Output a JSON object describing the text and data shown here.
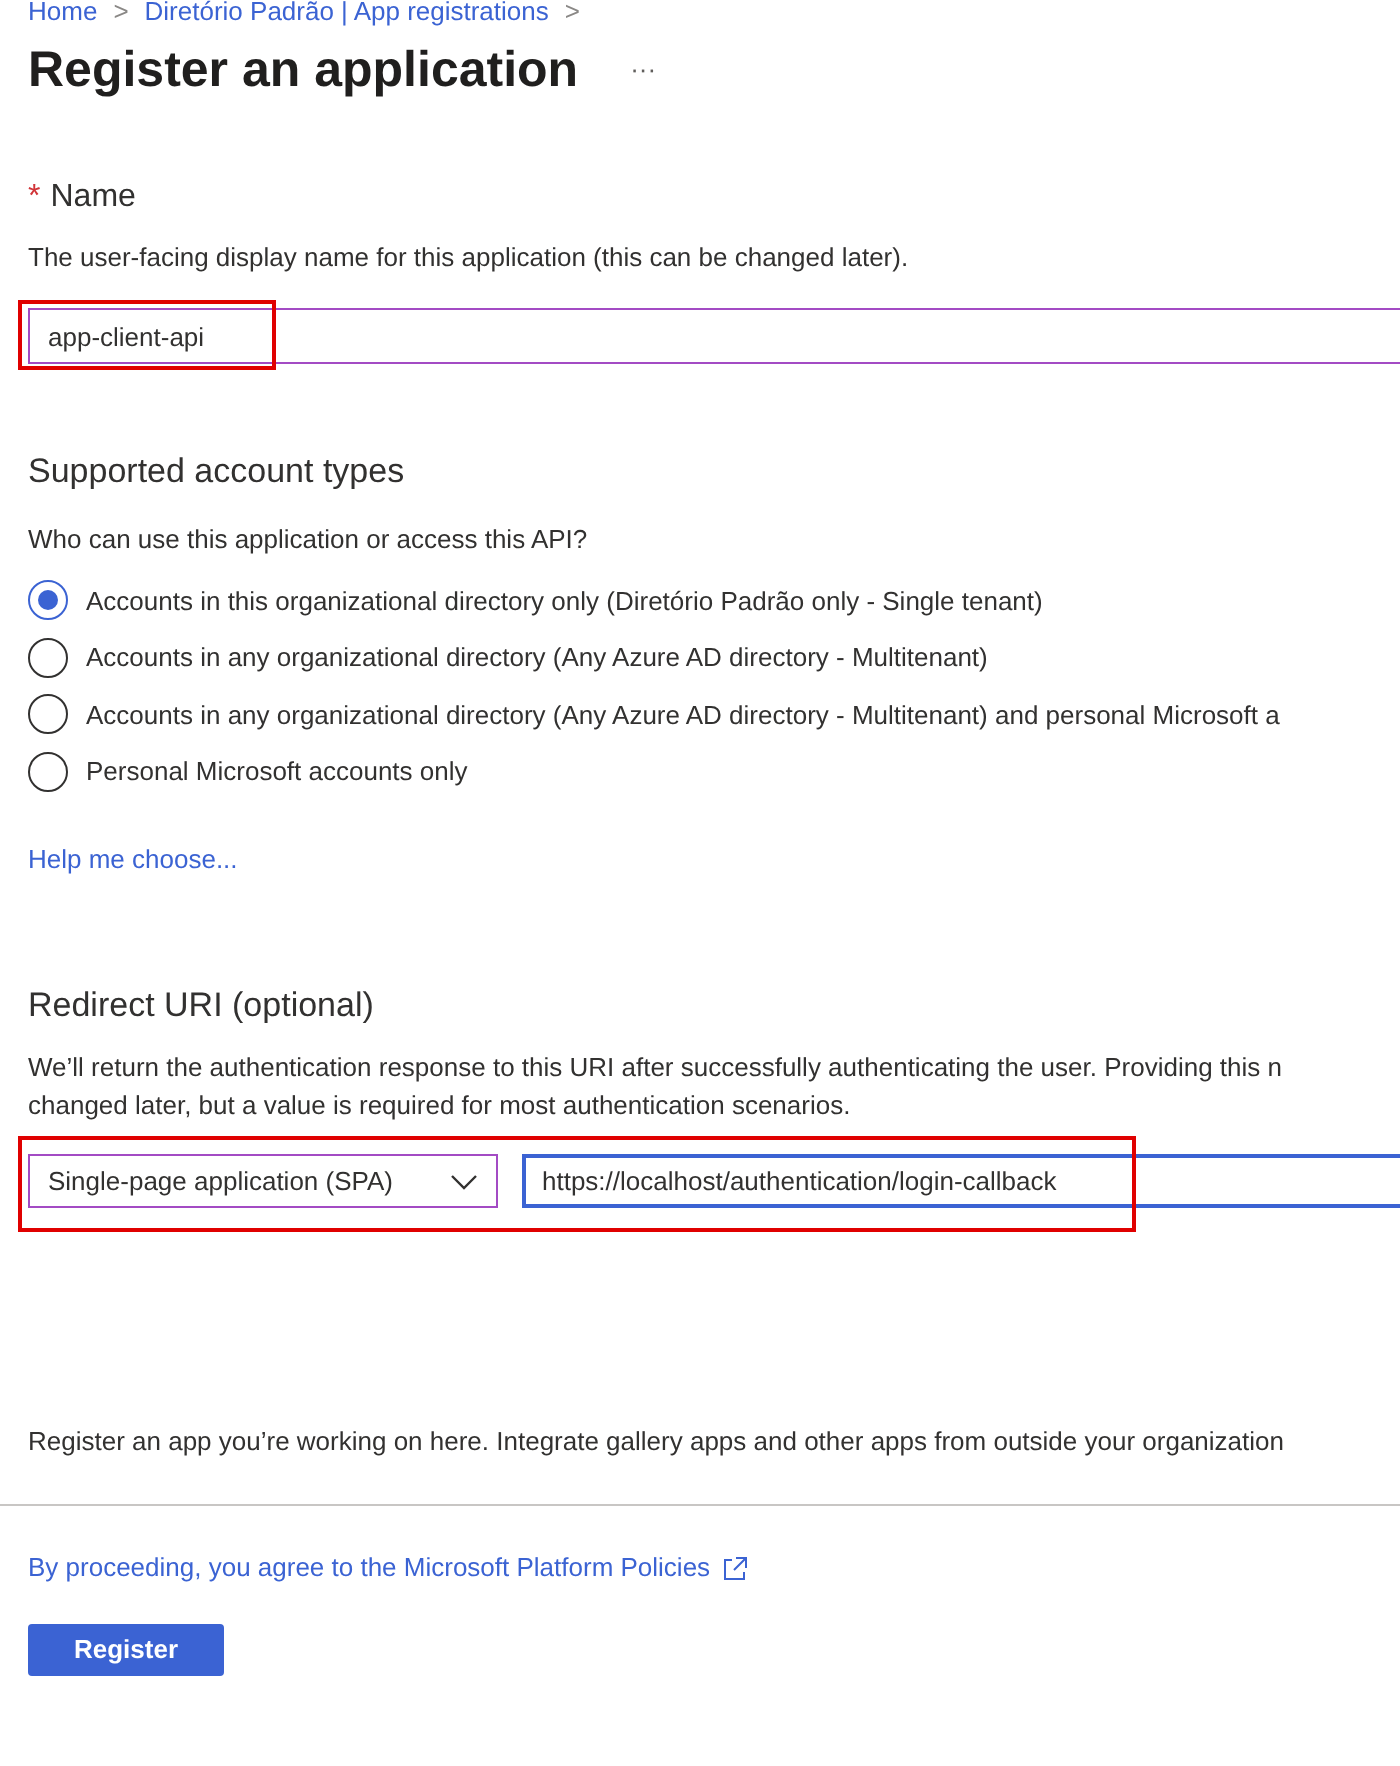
{
  "breadcrumb": [
    {
      "label": "Home"
    },
    {
      "label": "Diretório Padrão | App registrations"
    }
  ],
  "breadcrumb_separator": ">",
  "title": "Register an application",
  "more_menu": "···",
  "name_section": {
    "required_mark": "*",
    "label": "Name",
    "description": "The user-facing display name for this application (this can be changed later).",
    "value": "app-client-api"
  },
  "account_types": {
    "heading": "Supported account types",
    "question": "Who can use this application or access this API?",
    "options": [
      {
        "label": "Accounts in this organizational directory only (Diretório Padrão only - Single tenant)",
        "selected": true
      },
      {
        "label": "Accounts in any organizational directory (Any Azure AD directory - Multitenant)",
        "selected": false
      },
      {
        "label": "Accounts in any organizational directory (Any Azure AD directory - Multitenant) and personal Microsoft a",
        "selected": false
      },
      {
        "label": "Personal Microsoft accounts only",
        "selected": false
      }
    ],
    "help_link": "Help me choose..."
  },
  "redirect": {
    "heading": "Redirect URI (optional)",
    "description_lines": [
      "We’ll return the authentication response to this URI after successfully authenticating the user. Providing this n",
      "changed later, but a value is required for most authentication scenarios."
    ],
    "platform": "Single-page application (SPA)",
    "uri": "https://localhost/authentication/login-callback"
  },
  "gallery_note": "Register an app you’re working on here. Integrate gallery apps and other apps from outside your organization",
  "policy_link": "By proceeding, you agree to the Microsoft Platform Policies",
  "register_button": "Register"
}
